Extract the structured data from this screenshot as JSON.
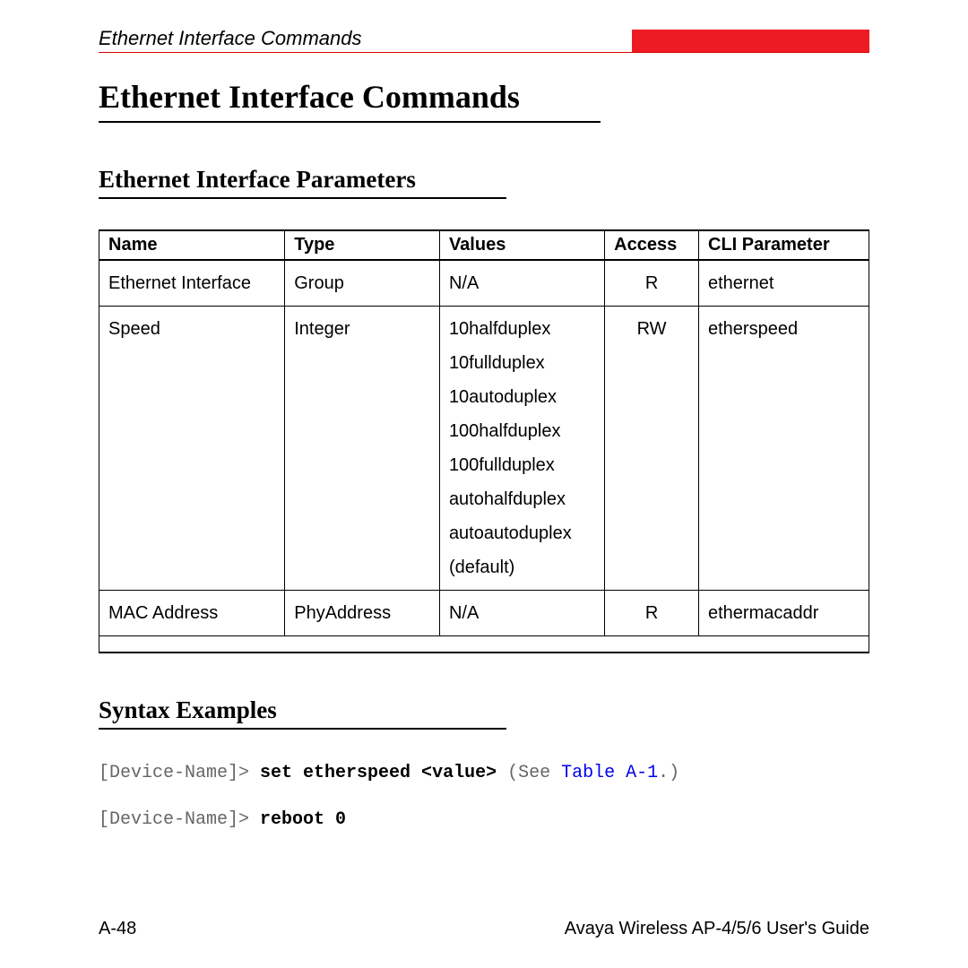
{
  "header": {
    "running_title": "Ethernet Interface Commands"
  },
  "titles": {
    "main": "Ethernet Interface Commands",
    "params": "Ethernet Interface Parameters",
    "syntax": "Syntax Examples"
  },
  "table": {
    "headers": {
      "name": "Name",
      "type": "Type",
      "values": "Values",
      "access": "Access",
      "cli": "CLI Parameter"
    },
    "rows": [
      {
        "name": "Ethernet Interface",
        "type": "Group",
        "values": "N/A",
        "access": "R",
        "cli": "ethernet"
      },
      {
        "name": "Speed",
        "type": "Integer",
        "values": "10halfduplex\n10fullduplex\n10autoduplex\n100halfduplex\n100fullduplex\nautohalfduplex\nautoautoduplex (default)",
        "access": "RW",
        "cli": "etherspeed"
      },
      {
        "name": "MAC Address",
        "type": "PhyAddress",
        "values": "N/A",
        "access": "R",
        "cli": "ethermacaddr"
      }
    ]
  },
  "code": {
    "line1_prompt": "[Device-Name]> ",
    "line1_cmd": "set etherspeed <value>",
    "line1_note_prefix": " (See ",
    "line1_link": "Table A-1",
    "line1_note_suffix": ".)",
    "line2_prompt": "[Device-Name]> ",
    "line2_cmd": "reboot 0"
  },
  "footer": {
    "page": "A-48",
    "guide": "Avaya Wireless AP-4/5/6 User's Guide"
  }
}
